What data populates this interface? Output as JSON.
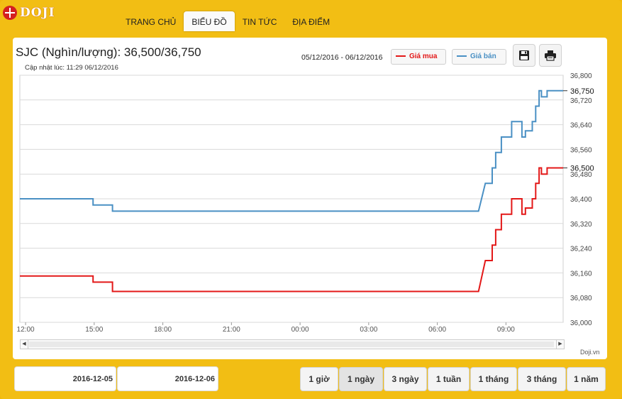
{
  "brand": {
    "name": "DOJI"
  },
  "nav": {
    "items": [
      "TRANG CHỦ",
      "BIỂU ĐỒ",
      "TIN TỨC",
      "ĐỊA ĐIỂM"
    ],
    "active": "BIỂU ĐỒ"
  },
  "header": {
    "title": "SJC (Nghìn/lượng): 36,500/36,750",
    "updated": "Cập nhật lúc: 11:29 06/12/2016",
    "date_range": "05/12/2016 - 06/12/2016"
  },
  "legend": {
    "buy_label": "Giá mua",
    "sell_label": "Giá bán"
  },
  "colors": {
    "buy": "#e31818",
    "sell": "#4a90c4",
    "accent": "#f2be14"
  },
  "icons": {
    "save": "save-icon",
    "print": "print-icon"
  },
  "credit": "Doji.vn",
  "footer": {
    "from_date": "2016-12-05",
    "to_date": "2016-12-06",
    "ranges": [
      "1 giờ",
      "1 ngày",
      "3 ngày",
      "1 tuần",
      "1 tháng",
      "3 tháng",
      "1 năm"
    ],
    "active_range": "1 ngày"
  },
  "chart_data": {
    "type": "line",
    "x_tick_labels": [
      "12:00",
      "15:00",
      "18:00",
      "21:00",
      "00:00",
      "03:00",
      "06:00",
      "09:00"
    ],
    "y_tick_labels": [
      "36,800",
      "36,720",
      "36,640",
      "36,560",
      "36,480",
      "36,400",
      "36,320",
      "36,240",
      "36,160",
      "36,080",
      "36,000"
    ],
    "ylim": [
      36000,
      36800
    ],
    "xlim_hours": [
      11.75,
      35.5
    ],
    "grid": true,
    "last_value_labels": [
      "36,750",
      "36,500"
    ],
    "series": [
      {
        "name": "Giá bán",
        "color": "#4a90c4",
        "points": [
          [
            11.75,
            36400
          ],
          [
            14.95,
            36400
          ],
          [
            14.95,
            36380
          ],
          [
            15.8,
            36380
          ],
          [
            15.8,
            36360
          ],
          [
            31.8,
            36360
          ],
          [
            32.1,
            36450
          ],
          [
            32.4,
            36450
          ],
          [
            32.4,
            36500
          ],
          [
            32.55,
            36500
          ],
          [
            32.55,
            36550
          ],
          [
            32.8,
            36550
          ],
          [
            32.8,
            36600
          ],
          [
            33.25,
            36600
          ],
          [
            33.25,
            36650
          ],
          [
            33.7,
            36650
          ],
          [
            33.7,
            36600
          ],
          [
            33.85,
            36600
          ],
          [
            33.85,
            36620
          ],
          [
            34.15,
            36620
          ],
          [
            34.15,
            36650
          ],
          [
            34.3,
            36650
          ],
          [
            34.3,
            36700
          ],
          [
            34.45,
            36700
          ],
          [
            34.45,
            36750
          ],
          [
            34.55,
            36750
          ],
          [
            34.55,
            36730
          ],
          [
            34.8,
            36730
          ],
          [
            34.8,
            36750
          ],
          [
            35.5,
            36750
          ]
        ]
      },
      {
        "name": "Giá mua",
        "color": "#e31818",
        "points": [
          [
            11.75,
            36150
          ],
          [
            14.95,
            36150
          ],
          [
            14.95,
            36130
          ],
          [
            15.8,
            36130
          ],
          [
            15.8,
            36100
          ],
          [
            31.8,
            36100
          ],
          [
            32.1,
            36200
          ],
          [
            32.4,
            36200
          ],
          [
            32.4,
            36250
          ],
          [
            32.55,
            36250
          ],
          [
            32.55,
            36300
          ],
          [
            32.8,
            36300
          ],
          [
            32.8,
            36350
          ],
          [
            33.25,
            36350
          ],
          [
            33.25,
            36400
          ],
          [
            33.7,
            36400
          ],
          [
            33.7,
            36350
          ],
          [
            33.85,
            36350
          ],
          [
            33.85,
            36370
          ],
          [
            34.15,
            36370
          ],
          [
            34.15,
            36400
          ],
          [
            34.3,
            36400
          ],
          [
            34.3,
            36450
          ],
          [
            34.45,
            36450
          ],
          [
            34.45,
            36500
          ],
          [
            34.55,
            36500
          ],
          [
            34.55,
            36480
          ],
          [
            34.8,
            36480
          ],
          [
            34.8,
            36500
          ],
          [
            35.5,
            36500
          ]
        ]
      }
    ]
  }
}
